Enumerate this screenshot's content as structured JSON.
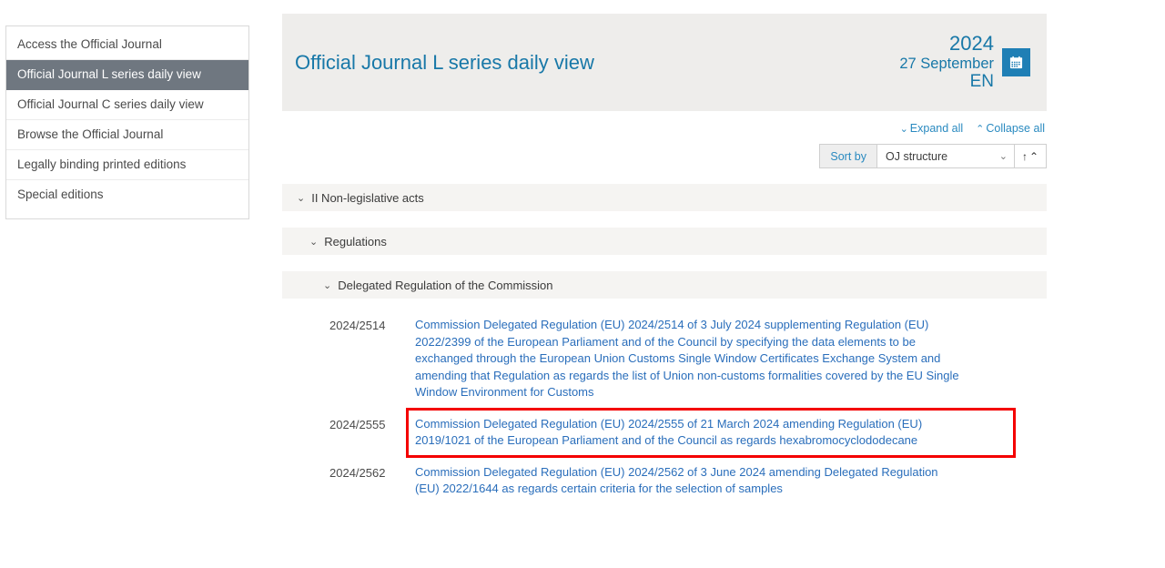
{
  "sidebar": {
    "items": [
      {
        "label": "Access the Official Journal",
        "selected": false
      },
      {
        "label": "Official Journal L series daily view",
        "selected": true
      },
      {
        "label": "Official Journal C series daily view",
        "selected": false
      },
      {
        "label": "Browse the Official Journal",
        "selected": false
      },
      {
        "label": "Legally binding printed editions",
        "selected": false
      },
      {
        "label": "Special editions",
        "selected": false
      }
    ]
  },
  "header": {
    "title": "Official Journal L series daily view",
    "year": "2024",
    "date": "27 September",
    "language": "EN",
    "calendar_icon": "calendar-icon"
  },
  "toolbar": {
    "expand_all": "Expand all",
    "collapse_all": "Collapse all",
    "expand_icon": "chevron-double-down-icon",
    "collapse_icon": "chevron-double-up-icon",
    "sort_by_label": "Sort by",
    "sort_value": "OJ structure",
    "sort_options": [
      "OJ structure"
    ],
    "sort_direction_icon": "sort-ascending-icon",
    "dropdown_icon": "chevron-down-icon"
  },
  "tree": {
    "chevron_icon": "chevron-down-icon",
    "sections": [
      {
        "label": "II Non-legislative acts",
        "level": 1
      },
      {
        "label": "Regulations",
        "level": 2
      },
      {
        "label": "Delegated Regulation of the Commission",
        "level": 3
      }
    ]
  },
  "documents": [
    {
      "number": "2024/2514",
      "title": "Commission Delegated Regulation (EU) 2024/2514 of 3 July 2024 supplementing Regulation (EU) 2022/2399 of the European Parliament and of the Council by specifying the data elements to be exchanged through the European Union Customs Single Window Certificates Exchange System and amending that Regulation as regards the list of Union non-customs formalities covered by the EU Single Window Environment for Customs",
      "highlighted": false
    },
    {
      "number": "2024/2555",
      "title": "Commission Delegated Regulation (EU) 2024/2555 of 21 March 2024 amending Regulation (EU) 2019/1021 of the European Parliament and of the Council as regards hexabromocyclododecane",
      "highlighted": true
    },
    {
      "number": "2024/2562",
      "title": "Commission Delegated Regulation (EU) 2024/2562 of 3 June 2024 amending Delegated Regulation (EU) 2022/1644 as regards certain criteria for the selection of samples",
      "highlighted": false
    }
  ],
  "annotation": {
    "highlight_color": "#f40000",
    "target_document": "2024/2555"
  }
}
